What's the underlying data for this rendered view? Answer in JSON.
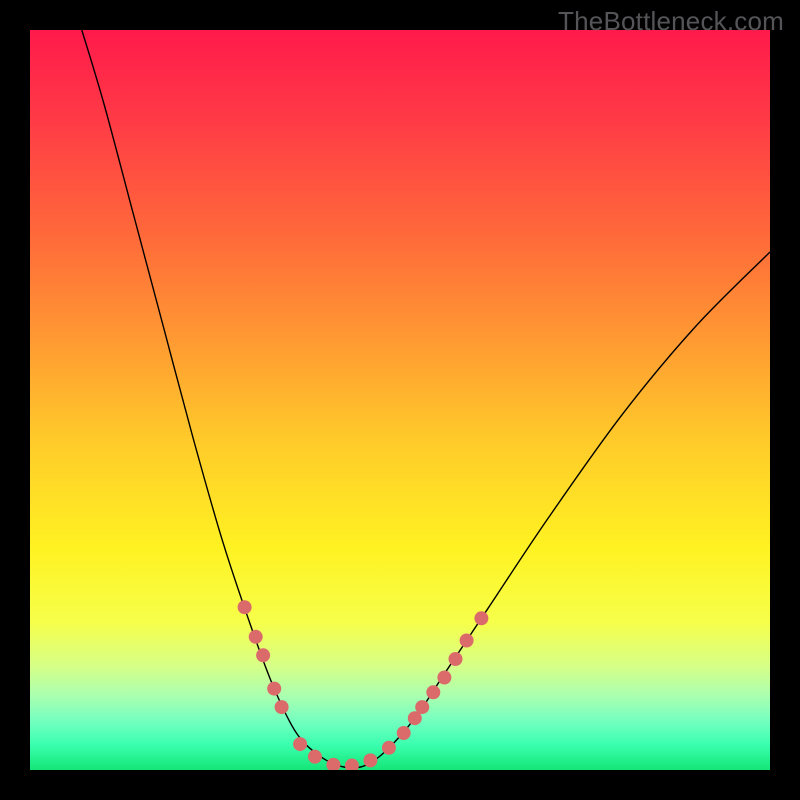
{
  "watermark": "TheBottleneck.com",
  "chart_data": {
    "type": "line",
    "title": "",
    "xlabel": "",
    "ylabel": "",
    "xlim": [
      0,
      100
    ],
    "ylim": [
      0,
      100
    ],
    "background_gradient": {
      "stops": [
        {
          "offset": 0.0,
          "color": "#ff1a4b"
        },
        {
          "offset": 0.12,
          "color": "#ff3a46"
        },
        {
          "offset": 0.28,
          "color": "#ff6a3a"
        },
        {
          "offset": 0.42,
          "color": "#ff9a32"
        },
        {
          "offset": 0.55,
          "color": "#ffc92a"
        },
        {
          "offset": 0.7,
          "color": "#fff222"
        },
        {
          "offset": 0.8,
          "color": "#f6ff4a"
        },
        {
          "offset": 0.86,
          "color": "#d6ff88"
        },
        {
          "offset": 0.9,
          "color": "#aaffb0"
        },
        {
          "offset": 0.935,
          "color": "#72ffc0"
        },
        {
          "offset": 0.965,
          "color": "#3bffb0"
        },
        {
          "offset": 1.0,
          "color": "#14e676"
        }
      ]
    },
    "series": [
      {
        "name": "curve",
        "type": "line",
        "color": "#000000",
        "width": 1.4,
        "points": [
          {
            "x": 7,
            "y": 100
          },
          {
            "x": 10,
            "y": 90
          },
          {
            "x": 14,
            "y": 75
          },
          {
            "x": 18,
            "y": 60
          },
          {
            "x": 22,
            "y": 45
          },
          {
            "x": 26,
            "y": 31
          },
          {
            "x": 30,
            "y": 19
          },
          {
            "x": 33,
            "y": 11
          },
          {
            "x": 36,
            "y": 5
          },
          {
            "x": 39,
            "y": 2
          },
          {
            "x": 42,
            "y": 0.5
          },
          {
            "x": 45,
            "y": 0.5
          },
          {
            "x": 48,
            "y": 2.5
          },
          {
            "x": 52,
            "y": 7
          },
          {
            "x": 56,
            "y": 13
          },
          {
            "x": 62,
            "y": 22
          },
          {
            "x": 70,
            "y": 34
          },
          {
            "x": 80,
            "y": 48
          },
          {
            "x": 90,
            "y": 60
          },
          {
            "x": 100,
            "y": 70
          }
        ]
      },
      {
        "name": "markers",
        "type": "scatter",
        "color": "#db6b6b",
        "radius": 7,
        "points": [
          {
            "x": 29,
            "y": 22
          },
          {
            "x": 30.5,
            "y": 18
          },
          {
            "x": 31.5,
            "y": 15.5
          },
          {
            "x": 33,
            "y": 11
          },
          {
            "x": 34,
            "y": 8.5
          },
          {
            "x": 36.5,
            "y": 3.5
          },
          {
            "x": 38.5,
            "y": 1.8
          },
          {
            "x": 41,
            "y": 0.7
          },
          {
            "x": 43.5,
            "y": 0.6
          },
          {
            "x": 46,
            "y": 1.3
          },
          {
            "x": 48.5,
            "y": 3
          },
          {
            "x": 50.5,
            "y": 5
          },
          {
            "x": 52,
            "y": 7
          },
          {
            "x": 53,
            "y": 8.5
          },
          {
            "x": 54.5,
            "y": 10.5
          },
          {
            "x": 56,
            "y": 12.5
          },
          {
            "x": 57.5,
            "y": 15
          },
          {
            "x": 59,
            "y": 17.5
          },
          {
            "x": 61,
            "y": 20.5
          }
        ]
      }
    ]
  }
}
